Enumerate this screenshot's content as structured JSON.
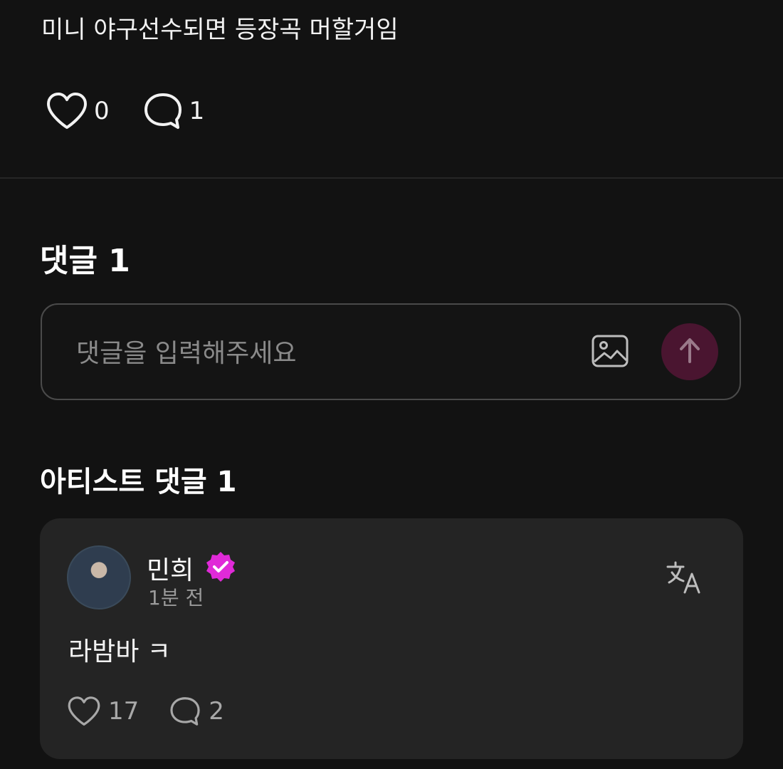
{
  "post": {
    "text": "미니 야구선수되면 등장곡 머할거임",
    "likes": "0",
    "comments": "1"
  },
  "comments_section": {
    "title": "댓글 1",
    "input_placeholder": "댓글을 입력해주세요"
  },
  "artist_section": {
    "title": "아티스트 댓글 1",
    "comment": {
      "author": "민희",
      "time": "1분 전",
      "text": "라밤바 ㅋ",
      "likes": "17",
      "replies": "2"
    }
  },
  "colors": {
    "background": "#121212",
    "card": "#242424",
    "send_button": "#4a1530",
    "verified_badge": "#e02ad8"
  },
  "icons": {
    "like": "heart-icon",
    "comment": "speech-bubble-icon",
    "image": "image-icon",
    "send": "arrow-up-icon",
    "verified": "verified-badge-icon",
    "translate": "translate-icon"
  }
}
